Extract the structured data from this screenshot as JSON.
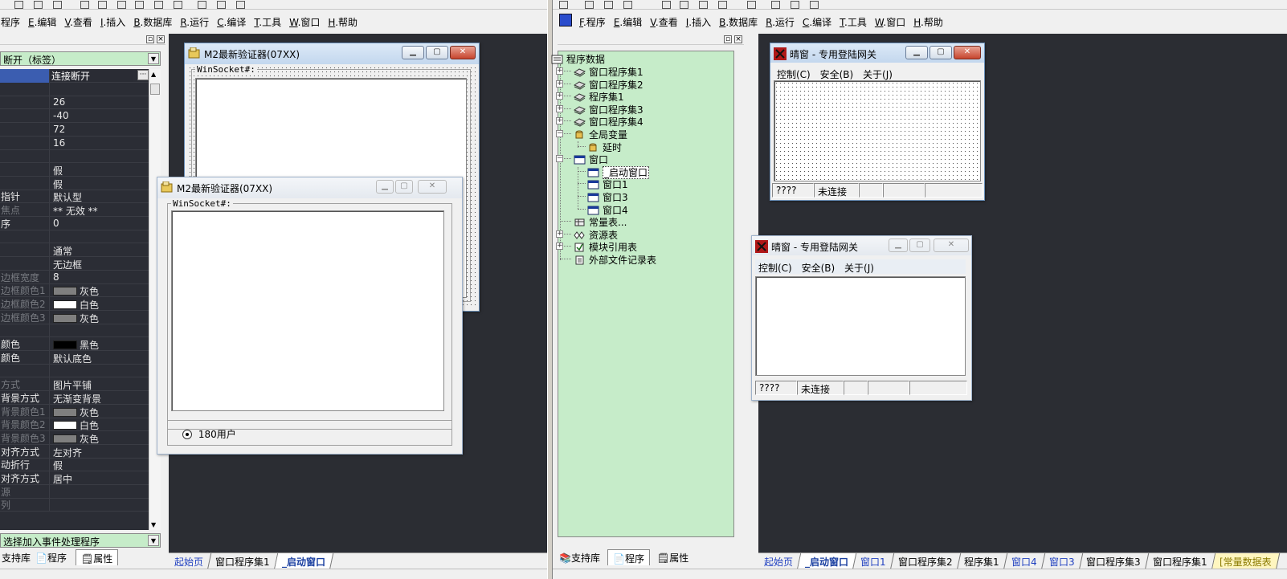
{
  "left_menu": [
    {
      "label": "程序"
    },
    {
      "key": "E",
      "label": ".编辑"
    },
    {
      "key": "V",
      "label": ".查看"
    },
    {
      "key": "I",
      "label": ".插入"
    },
    {
      "key": "B",
      "label": ".数据库"
    },
    {
      "key": "R",
      "label": ".运行"
    },
    {
      "key": "C",
      "label": ".编译"
    },
    {
      "key": "T",
      "label": ".工具"
    },
    {
      "key": "W",
      "label": ".窗口"
    },
    {
      "key": "H",
      "label": ".帮助"
    }
  ],
  "right_menu": [
    {
      "key": "F",
      "label": ".程序"
    },
    {
      "key": "E",
      "label": ".编辑"
    },
    {
      "key": "V",
      "label": ".查看"
    },
    {
      "key": "I",
      "label": ".插入"
    },
    {
      "key": "B",
      "label": ".数据库"
    },
    {
      "key": "R",
      "label": ".运行"
    },
    {
      "key": "C",
      "label": ".编译"
    },
    {
      "key": "T",
      "label": ".工具"
    },
    {
      "key": "W",
      "label": ".窗口"
    },
    {
      "key": "H",
      "label": ".帮助"
    }
  ],
  "props": {
    "selector": "断开（标签）",
    "event_selector": "选择加入事件处理程序",
    "rows": [
      {
        "name": "",
        "value": "连接断开",
        "selected": true
      },
      {
        "name": "",
        "value": ""
      },
      {
        "name": "",
        "value": "26"
      },
      {
        "name": "",
        "value": "-40"
      },
      {
        "name": "",
        "value": "72"
      },
      {
        "name": "",
        "value": "16"
      },
      {
        "name": "",
        "value": ""
      },
      {
        "name": "",
        "value": "假"
      },
      {
        "name": "",
        "value": "假"
      },
      {
        "name": "指针",
        "value": "默认型",
        "lit": true
      },
      {
        "name": "焦点",
        "value": "** 无效 **"
      },
      {
        "name": "序",
        "value": "0",
        "lit": true
      },
      {
        "name": "",
        "value": ""
      },
      {
        "name": "",
        "value": "通常"
      },
      {
        "name": "",
        "value": "无边框"
      },
      {
        "name": "边框宽度",
        "value": "8"
      },
      {
        "name": "边框颜色1",
        "value": "灰色",
        "swatch": "#7f7f7f"
      },
      {
        "name": "边框颜色2",
        "value": "白色",
        "swatch": "#ffffff"
      },
      {
        "name": "边框颜色3",
        "value": "灰色",
        "swatch": "#7f7f7f"
      },
      {
        "name": "",
        "value": ""
      },
      {
        "name": "颜色",
        "value": "黑色",
        "swatch": "#000000",
        "lit": true
      },
      {
        "name": "颜色",
        "value": "默认底色",
        "lit": true
      },
      {
        "name": "",
        "value": ""
      },
      {
        "name": "方式",
        "value": "图片平铺"
      },
      {
        "name": "背景方式",
        "value": "无渐变背景",
        "lit": true
      },
      {
        "name": "背景颜色1",
        "value": "灰色",
        "swatch": "#7f7f7f"
      },
      {
        "name": "背景颜色2",
        "value": "白色",
        "swatch": "#ffffff"
      },
      {
        "name": "背景颜色3",
        "value": "灰色",
        "swatch": "#7f7f7f"
      },
      {
        "name": "对齐方式",
        "value": "左对齐",
        "lit": true
      },
      {
        "name": "动折行",
        "value": "假",
        "lit": true
      },
      {
        "name": "对齐方式",
        "value": "居中",
        "lit": true
      },
      {
        "name": "源",
        "value": ""
      },
      {
        "name": "列",
        "value": ""
      }
    ]
  },
  "left_bottom_tabs": [
    "支持库",
    "程序",
    "属性"
  ],
  "left_doc_tabs": [
    "起始页",
    "窗口程序集1",
    "_启动窗口"
  ],
  "verifier_back": {
    "title": "M2最新验证器(07XX)",
    "group": "WinSocket#:"
  },
  "verifier_front": {
    "title": "M2最新验证器(07XX)",
    "group": "WinSocket#:",
    "radio": "180用户"
  },
  "tree": {
    "root": "程序数据",
    "nodes": [
      {
        "label": "窗口程序集1",
        "icon": "module",
        "expander": "+"
      },
      {
        "label": "窗口程序集2",
        "icon": "module",
        "expander": "+"
      },
      {
        "label": "程序集1",
        "icon": "module",
        "expander": "+"
      },
      {
        "label": "窗口程序集3",
        "icon": "module",
        "expander": "+"
      },
      {
        "label": "窗口程序集4",
        "icon": "module",
        "expander": "+"
      },
      {
        "label": "全局变量",
        "icon": "db",
        "expander": "-"
      },
      {
        "label": "延时",
        "icon": "db",
        "child": true
      },
      {
        "label": "窗口",
        "icon": "window",
        "expander": "-"
      },
      {
        "label": "_启动窗口",
        "icon": "window",
        "child": true,
        "highlight": true
      },
      {
        "label": "窗口1",
        "icon": "window",
        "child": true
      },
      {
        "label": "窗口3",
        "icon": "window",
        "child": true
      },
      {
        "label": "窗口4",
        "icon": "window",
        "child": true
      },
      {
        "label": "常量表...",
        "icon": "const"
      },
      {
        "label": "资源表",
        "icon": "res",
        "expander": "+"
      },
      {
        "label": "模块引用表",
        "icon": "ref",
        "expander": "+"
      },
      {
        "label": "外部文件记录表",
        "icon": "doc"
      }
    ]
  },
  "right_bottom_tabs": [
    "支持库",
    "程序",
    "属性"
  ],
  "right_doc_tabs": [
    "起始页",
    "_启动窗口",
    "窗口1",
    "窗口程序集2",
    "程序集1",
    "窗口4",
    "窗口3",
    "窗口程序集3",
    "窗口程序集1",
    "[常量数据表"
  ],
  "gateway_back": {
    "title": "晴窗 - 专用登陆网关",
    "menu": [
      "控制(C)",
      "安全(B)",
      "关于(J)"
    ],
    "status": [
      "????",
      "未连接",
      "",
      "",
      ""
    ]
  },
  "gateway_front": {
    "title": "晴窗 - 专用登陆网关",
    "menu": [
      "控制(C)",
      "安全(B)",
      "关于(J)"
    ],
    "status": [
      "????",
      "未连接",
      "",
      "",
      ""
    ]
  },
  "colors": {
    "dark_bg": "#2b2d33",
    "tree_bg": "#c6ecc9",
    "active_title": "#c3d7ee",
    "close_red": "#c7452e"
  }
}
